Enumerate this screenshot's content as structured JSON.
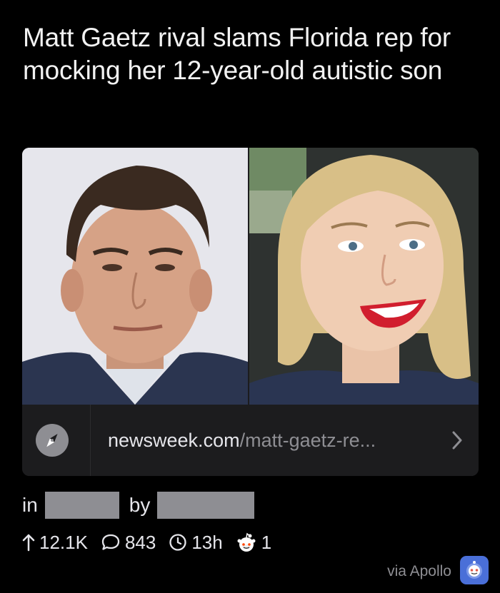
{
  "post": {
    "title": "Matt Gaetz rival slams Florida rep for mocking her 12-year-old autistic son"
  },
  "link_card": {
    "domain": "newsweek.com",
    "path": "/matt-gaetz-re...",
    "icon": "compass-icon",
    "chevron": ">"
  },
  "meta": {
    "in_label": "in",
    "by_label": "by"
  },
  "stats": {
    "upvotes": "12.1K",
    "comments": "843",
    "age": "13h",
    "awards": "1"
  },
  "footer": {
    "via_label": "via Apollo"
  },
  "colors": {
    "background": "#000000",
    "card": "#1c1c1e",
    "muted": "#8e8e93",
    "apollo": "#4a6fd8"
  }
}
